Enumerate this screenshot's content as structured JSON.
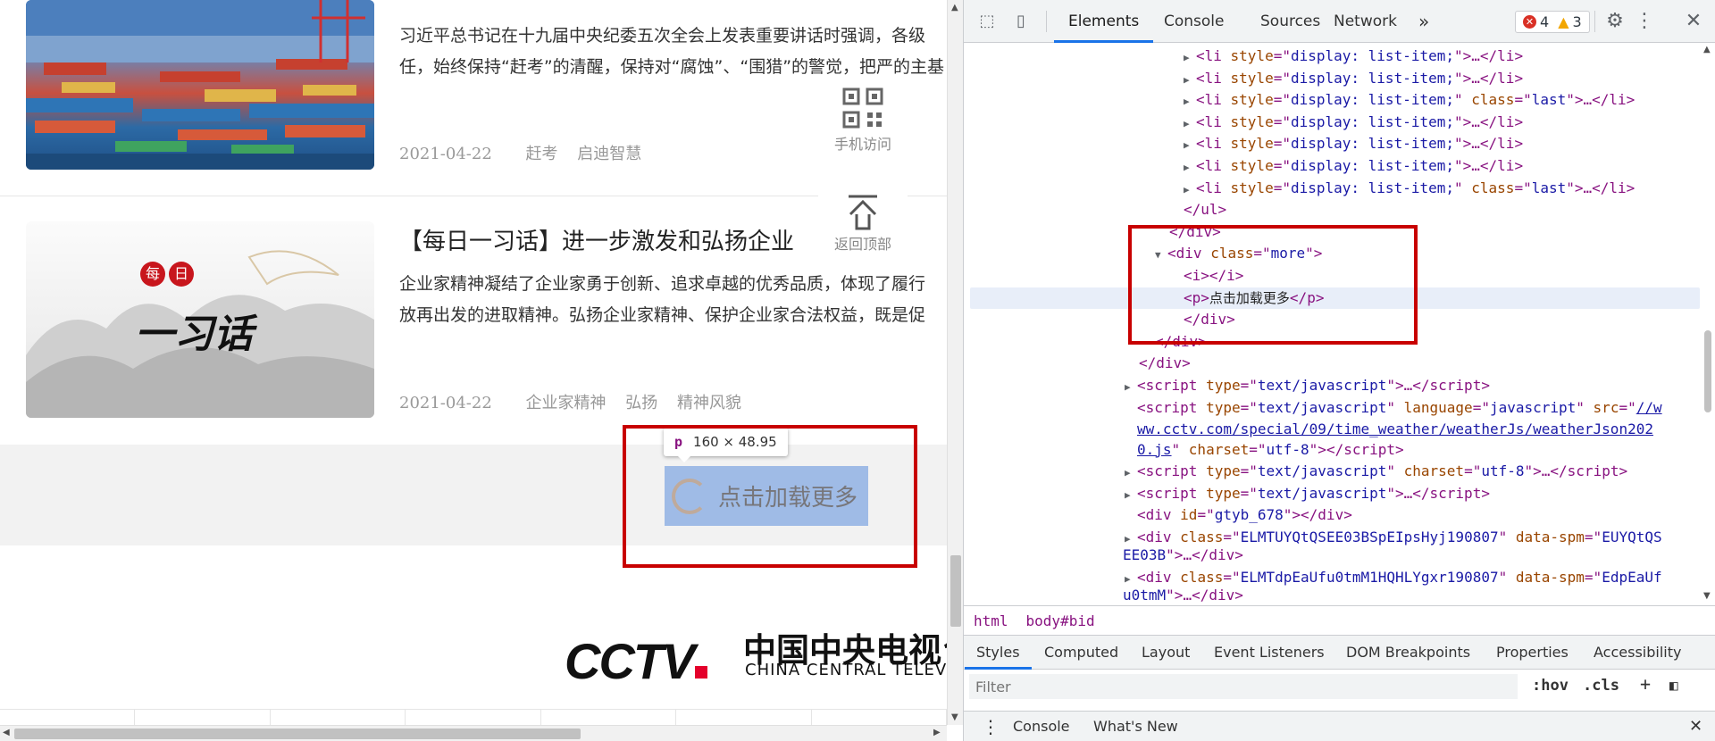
{
  "page": {
    "articles": [
      {
        "title": "",
        "desc_line1": "习近平总书记在十九届中央纪委五次全会上发表重要讲话时强调，各级",
        "desc_line2": "任，始终保持“赶考”的清醒，保持对“腐蚀”、“围猎”的警觉，把严的主基",
        "date": "2021-04-22",
        "tags": [
          "赶考",
          "启迪智慧"
        ]
      },
      {
        "title": "【每日一习话】进一步激发和弘扬企业",
        "desc_line1": "企业家精神凝结了企业家勇于创新、追求卓越的优秀品质，体现了履行",
        "desc_line2": "放再出发的进取精神。弘扬企业家精神、保护企业家合法权益，既是促",
        "date": "2021-04-22",
        "tags": [
          "企业家精神",
          "弘扬",
          "精神风貌"
        ]
      }
    ],
    "thumb2_badge": [
      "每",
      "日"
    ],
    "thumb2_calligraphy": "一习话",
    "float_qr_label": "手机访问",
    "float_top_label": "返回顶部",
    "load_more_text": "点击加载更多",
    "highlight_tooltip": {
      "tag": "p",
      "size": "160 × 48.95"
    },
    "footer": {
      "logo_text": "CCTV",
      "cn_name": "中国中央电视台",
      "en_name": "CHINA CENTRAL TELEVISION"
    }
  },
  "devtools": {
    "tabs": [
      "Elements",
      "Console",
      "Sources",
      "Network"
    ],
    "more_tabs": "»",
    "errors": "4",
    "warnings": "3",
    "dom_lines": [
      {
        "k": "li",
        "attr": "style",
        "val": "display: list-item;",
        "extra": "",
        "close": ">…</li>"
      },
      {
        "k": "li",
        "attr": "style",
        "val": "display: list-item;",
        "extra": "",
        "close": ">…</li>"
      },
      {
        "k": "li",
        "attr": "style",
        "val": "display: list-item;",
        "extra": "last",
        "close": ">…</li>"
      },
      {
        "k": "li",
        "attr": "style",
        "val": "display: list-item;",
        "extra": "",
        "close": ">…</li>"
      },
      {
        "k": "li",
        "attr": "style",
        "val": "display: list-item;",
        "extra": "",
        "close": ">…</li>"
      },
      {
        "k": "li",
        "attr": "style",
        "val": "display: list-item;",
        "extra": "",
        "close": ">…</li>"
      },
      {
        "k": "li",
        "attr": "style",
        "val": "display: list-item;",
        "extra": "last",
        "close": ">…</li>"
      }
    ],
    "ul_close": "</ul>",
    "div_close": "</div>",
    "more_div": {
      "tag": "div",
      "attr": "class",
      "val": "more"
    },
    "i_line": "<i></i>",
    "p_open": "<p>",
    "p_text": "点击加载更多",
    "p_close": "</p>",
    "script_lines": {
      "s1_attr_val": "text/javascript",
      "s2_src": "//www.cctv.com/special/09/time_weather/weatherJs/weatherJson2020.js",
      "s2_src_part1": "//w",
      "s2_src_part2": "ww.cctv.com/special/09/time_weather/weatherJs/weatherJson202",
      "s2_src_part3": "0.js",
      "s2_charset": "utf-8",
      "s2_language": "javascript",
      "s3_charset": "utf-8",
      "gtyb_id": "gtyb_678",
      "elm1_class": "ELMTUYQtQSEE03BSpEIpsHyj190807",
      "elm1_spm_a": "EUYQtQS",
      "elm1_spm_b": "EE03B",
      "elm2_class": "ELMTdpEaUfu0tmM1HQHLYgxr190807",
      "elm2_spm_a": "EdpEaUf",
      "elm2_spm_b": "u0tmM"
    },
    "breadcrumbs": [
      "html",
      "body#bid"
    ],
    "styles_tabs": [
      "Styles",
      "Computed",
      "Layout",
      "Event Listeners",
      "DOM Breakpoints",
      "Properties",
      "Accessibility"
    ],
    "filter_placeholder": "Filter",
    "hov": ":hov",
    "cls": ".cls",
    "drawer_tabs": [
      "Console",
      "What's New"
    ]
  }
}
